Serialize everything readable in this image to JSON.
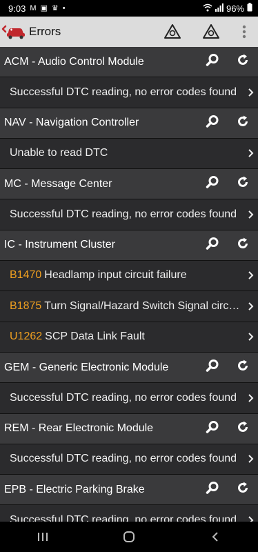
{
  "status": {
    "time": "9:03",
    "battery": "96%"
  },
  "appbar": {
    "title": "Errors"
  },
  "modules": [
    {
      "name": "ACM - Audio Control Module",
      "items": [
        {
          "code": "",
          "text": "Successful DTC reading, no error codes found"
        }
      ]
    },
    {
      "name": "NAV - Navigation Controller",
      "items": [
        {
          "code": "",
          "text": "Unable to read DTC"
        }
      ]
    },
    {
      "name": "MC - Message Center",
      "items": [
        {
          "code": "",
          "text": "Successful DTC reading, no error codes found"
        }
      ]
    },
    {
      "name": "IC - Instrument Cluster",
      "items": [
        {
          "code": "B1470",
          "text": "Headlamp input circuit failure"
        },
        {
          "code": "B1875",
          "text": "Turn Signal/Hazard Switch Signal circu…"
        },
        {
          "code": "U1262",
          "text": "SCP Data Link Fault"
        }
      ]
    },
    {
      "name": "GEM - Generic Electronic Module",
      "items": [
        {
          "code": "",
          "text": "Successful DTC reading, no error codes found"
        }
      ]
    },
    {
      "name": "REM - Rear Electronic Module",
      "items": [
        {
          "code": "",
          "text": "Successful DTC reading, no error codes found"
        }
      ]
    },
    {
      "name": "EPB - Electric Parking Brake",
      "items": [
        {
          "code": "",
          "text": "Successful DTC reading, no error codes found"
        }
      ]
    }
  ],
  "colors": {
    "code": "#f0a020",
    "header_bg": "#3a3a3c",
    "item_bg": "#2b2b2d",
    "appbar_bg": "#dcdcdc"
  }
}
